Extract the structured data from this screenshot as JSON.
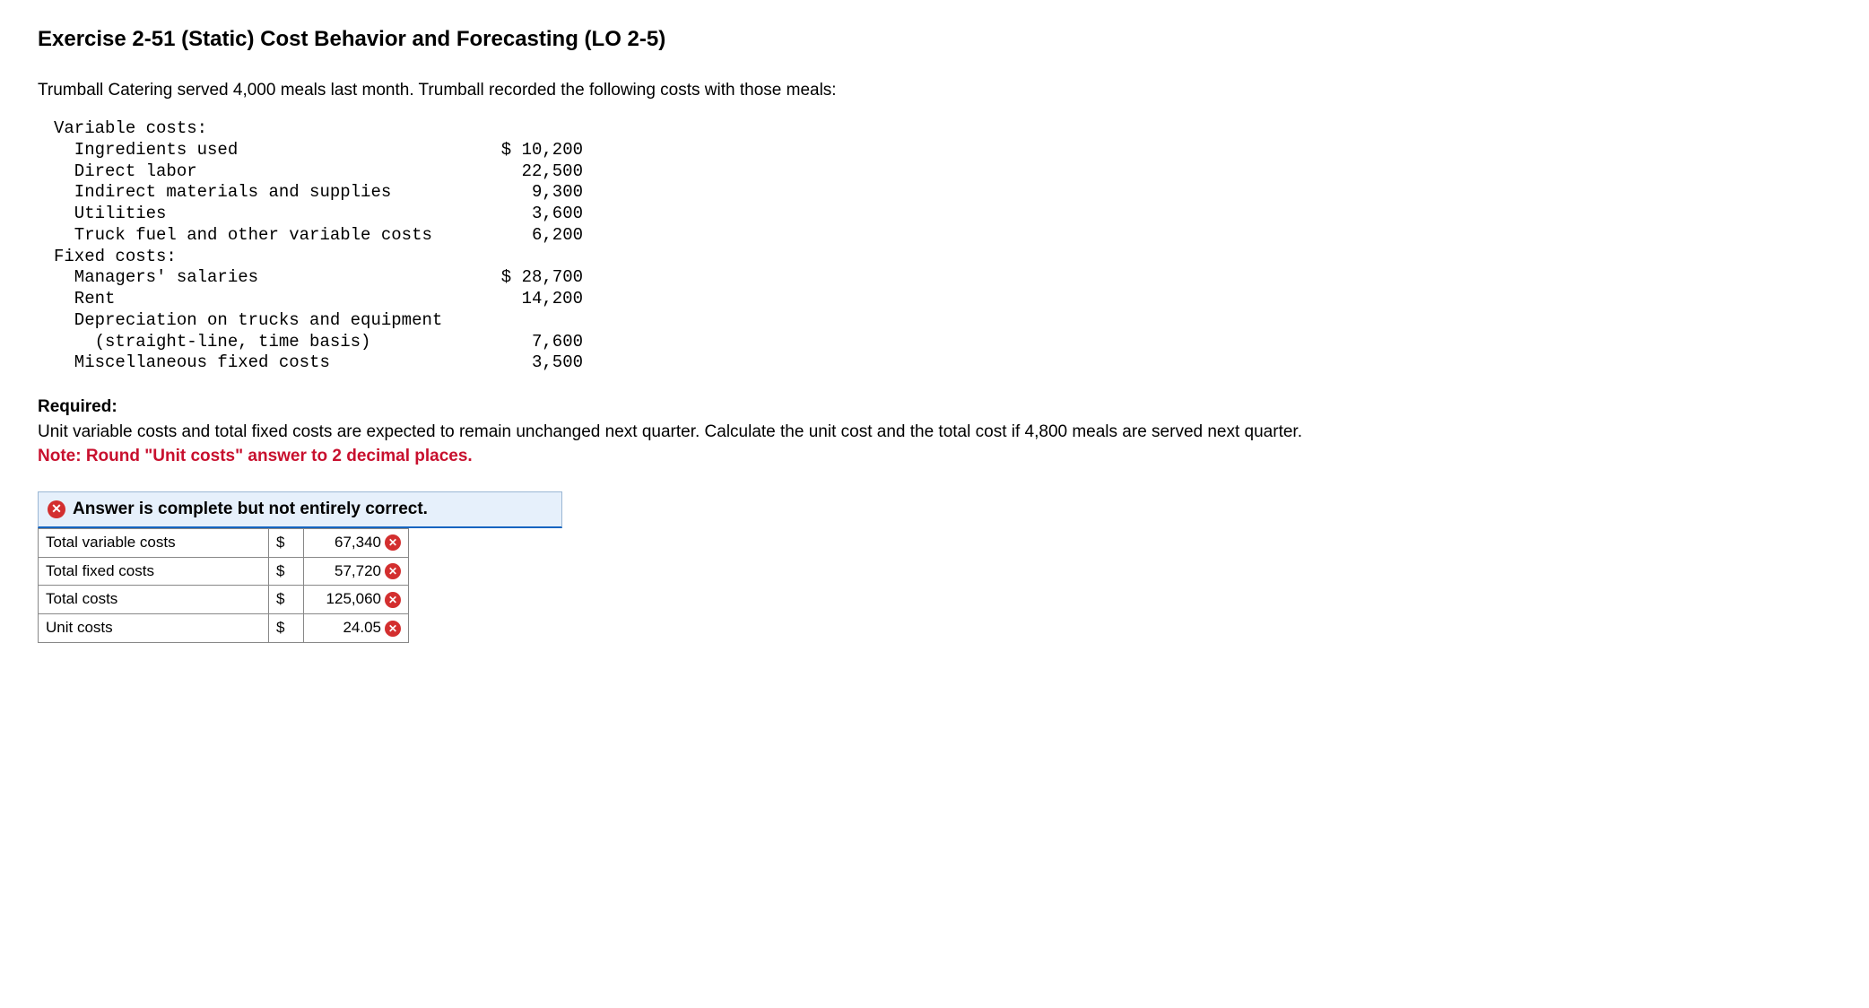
{
  "title": "Exercise 2-51 (Static) Cost Behavior and Forecasting (LO 2-5)",
  "intro": "Trumball Catering served 4,000 meals last month. Trumball recorded the following costs with those meals:",
  "cost_table": {
    "variable_header": "Variable costs:",
    "variable_items": [
      {
        "label": "Ingredients used",
        "value": "$ 10,200"
      },
      {
        "label": "Direct labor",
        "value": "22,500"
      },
      {
        "label": "Indirect materials and supplies",
        "value": "9,300"
      },
      {
        "label": "Utilities",
        "value": "3,600"
      },
      {
        "label": "Truck fuel and other variable costs",
        "value": "6,200"
      }
    ],
    "fixed_header": "Fixed costs:",
    "fixed_items": [
      {
        "label": "Managers' salaries",
        "value": "$ 28,700"
      },
      {
        "label": "Rent",
        "value": "14,200"
      },
      {
        "label": "Depreciation on trucks and equipment",
        "value": ""
      },
      {
        "label": "  (straight-line, time basis)",
        "value": "7,600"
      },
      {
        "label": "Miscellaneous fixed costs",
        "value": "3,500"
      }
    ]
  },
  "required_label": "Required:",
  "required_text": "Unit variable costs and total fixed costs are expected to remain unchanged next quarter. Calculate the unit cost and the total cost if 4,800 meals are served next quarter.",
  "note_text": "Note: Round \"Unit costs\" answer to 2 decimal places.",
  "feedback": {
    "text": "Answer is complete but not entirely correct."
  },
  "answers": [
    {
      "label": "Total variable costs",
      "currency": "$",
      "value": "67,340",
      "status": "incorrect"
    },
    {
      "label": "Total fixed costs",
      "currency": "$",
      "value": "57,720",
      "status": "incorrect"
    },
    {
      "label": "Total costs",
      "currency": "$",
      "value": "125,060",
      "status": "incorrect"
    },
    {
      "label": "Unit costs",
      "currency": "$",
      "value": "24.05",
      "status": "incorrect"
    }
  ]
}
